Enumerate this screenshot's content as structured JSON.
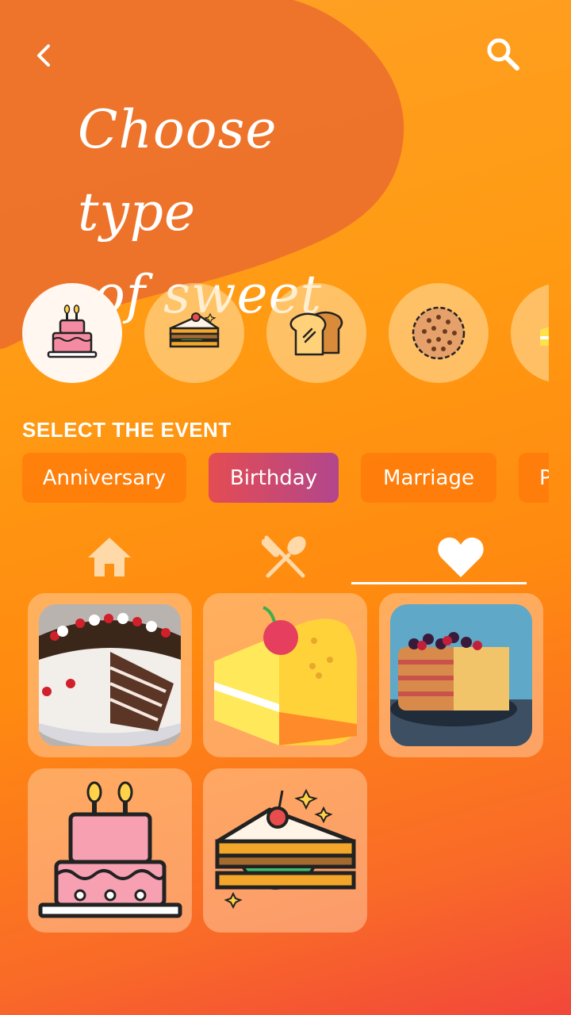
{
  "header": {
    "title_line1": "Choose type",
    "title_line2": "of sweet",
    "back_icon": "chevron-left-icon",
    "search_icon": "search-icon"
  },
  "categories": [
    {
      "name": "birthday-cake",
      "icon": "birthday-cake-icon",
      "active": true
    },
    {
      "name": "sandwich-cake",
      "icon": "sandwich-cake-icon",
      "active": false
    },
    {
      "name": "bread",
      "icon": "bread-icon",
      "active": false
    },
    {
      "name": "cookie",
      "icon": "cookie-icon",
      "active": false
    },
    {
      "name": "cheese-cake",
      "icon": "cheese-cake-icon",
      "active": false
    }
  ],
  "events": {
    "label": "SELECT THE EVENT",
    "items": [
      {
        "label": "Anniversary",
        "active": false
      },
      {
        "label": "Birthday",
        "active": true
      },
      {
        "label": "Marriage",
        "active": false
      },
      {
        "label": "P",
        "active": false
      }
    ]
  },
  "tabs": [
    {
      "icon": "home-icon",
      "active": false
    },
    {
      "icon": "fork-spoon-icon",
      "active": false
    },
    {
      "icon": "heart-icon",
      "active": true
    }
  ],
  "favorites": [
    {
      "item": "black-forest-cake-photo"
    },
    {
      "item": "cheese-cake-slice-icon"
    },
    {
      "item": "berry-layer-cake-photo"
    },
    {
      "item": "birthday-cake-icon"
    },
    {
      "item": "sandwich-cake-icon"
    }
  ],
  "colors": {
    "accent_gradient_start": "#e44c52",
    "accent_gradient_end": "#b2468c",
    "background_top": "#ffa126",
    "background_bottom": "#f2473a"
  }
}
